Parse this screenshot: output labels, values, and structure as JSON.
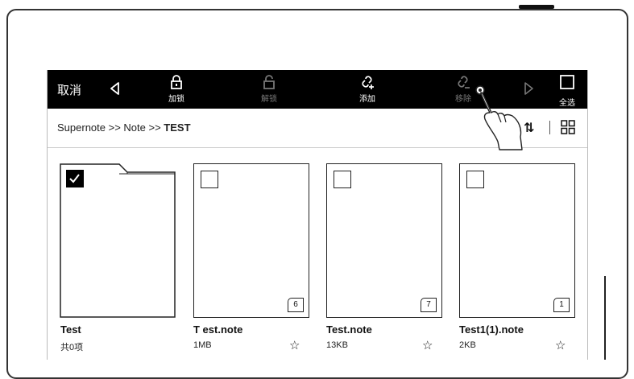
{
  "toolbar": {
    "cancel_label": "取消",
    "lock_label": "加锁",
    "unlock_label": "解锁",
    "add_label": "添加",
    "remove_label": "移除",
    "select_all_label": "全选"
  },
  "breadcrumb": {
    "path": "Supernote >> Note >> ",
    "current": "TEST"
  },
  "pathbar": {
    "sort_icon": "⇅"
  },
  "items": [
    {
      "name": "Test",
      "meta": "共0项",
      "type": "folder",
      "checked": true
    },
    {
      "name": "T est.note",
      "meta": "1MB",
      "type": "note",
      "pages": "6",
      "checked": false
    },
    {
      "name": "Test.note",
      "meta": "13KB",
      "type": "note",
      "pages": "7",
      "checked": false
    },
    {
      "name": "Test1(1).note",
      "meta": "2KB",
      "type": "note",
      "pages": "1",
      "checked": false
    }
  ],
  "icons": {
    "star": "☆"
  }
}
